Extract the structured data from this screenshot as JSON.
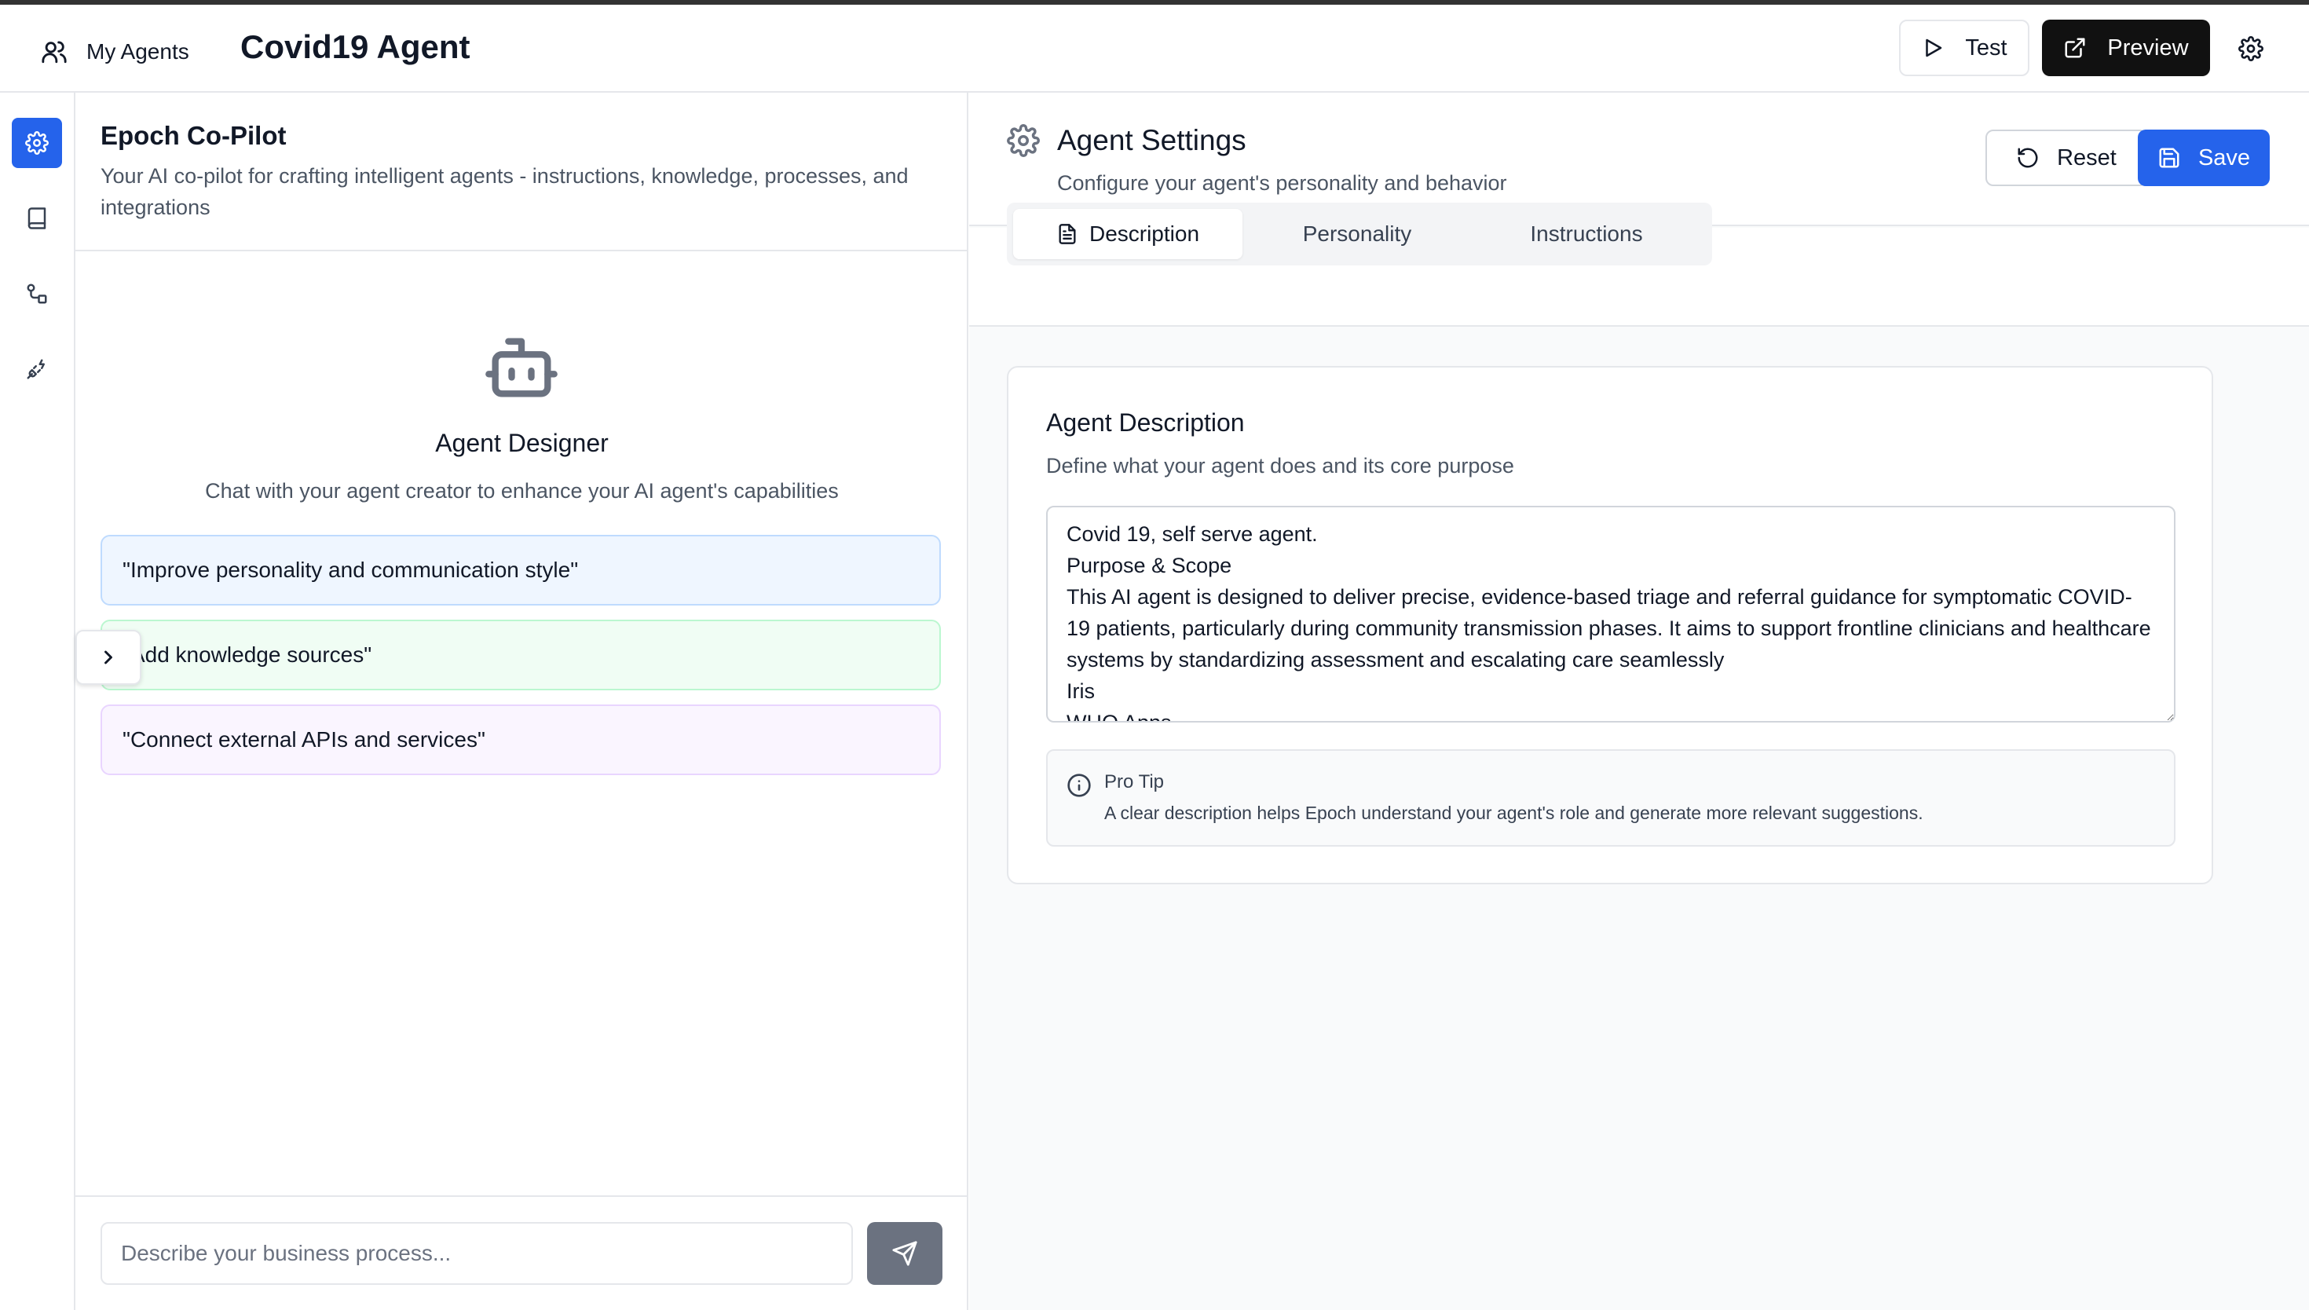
{
  "header": {
    "agents_label": "My Agents",
    "title": "Covid19 Agent",
    "test_label": "Test",
    "preview_label": "Preview"
  },
  "rail": {
    "items": [
      {
        "icon": "gear-icon",
        "active": true
      },
      {
        "icon": "book-icon",
        "active": false
      },
      {
        "icon": "workflow-icon",
        "active": false
      },
      {
        "icon": "plug-icon",
        "active": false
      }
    ]
  },
  "copilot": {
    "title": "Epoch Co-Pilot",
    "subtitle": "Your AI co-pilot for crafting intelligent agents - instructions, knowledge, processes, and integrations",
    "designer_title": "Agent Designer",
    "designer_subtitle": "Chat with your agent creator to enhance your AI agent's capabilities",
    "suggestions": [
      "\"Improve personality and communication style\"",
      "\"Add knowledge sources\"",
      "\"Connect external APIs and services\""
    ],
    "input_placeholder": "Describe your business process..."
  },
  "settings": {
    "title": "Agent Settings",
    "subtitle": "Configure your agent's personality and behavior",
    "reset_label": "Reset",
    "save_label": "Save",
    "tabs": [
      "Description",
      "Personality",
      "Instructions"
    ],
    "active_tab": "Description",
    "card_title": "Agent Description",
    "card_subtitle": "Define what your agent does and its core purpose",
    "description_value": "Covid 19, self serve agent.\nPurpose & Scope\nThis AI agent is designed to deliver precise, evidence-based triage and referral guidance for symptomatic COVID-19 patients, particularly during community transmission phases. It aims to support frontline clinicians and healthcare systems by standardizing assessment and escalating care seamlessly\nIris\nWHO Apps",
    "tip_title": "Pro Tip",
    "tip_text": "A clear description helps Epoch understand your agent's role and generate more relevant suggestions."
  },
  "colors": {
    "accent": "#2563eb",
    "dark_button": "#111111",
    "send_button": "#6b7280"
  }
}
